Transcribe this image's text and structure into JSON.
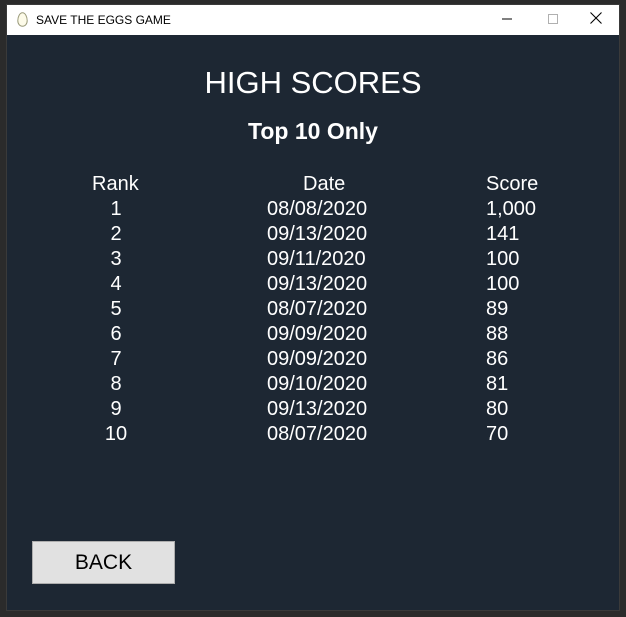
{
  "window": {
    "title": "SAVE THE EGGS GAME",
    "icon": "egg-icon",
    "controls": [
      "minimize-icon",
      "maximize-icon",
      "close-icon"
    ]
  },
  "screen": {
    "title": "HIGH SCORES",
    "subtitle": "Top 10 Only"
  },
  "table": {
    "headers": {
      "rank": "Rank",
      "date": "Date",
      "score": "Score"
    },
    "rows": [
      {
        "rank": "1",
        "date": "08/08/2020",
        "score": "1,000"
      },
      {
        "rank": "2",
        "date": "09/13/2020",
        "score": "141"
      },
      {
        "rank": "3",
        "date": "09/11/2020",
        "score": "100"
      },
      {
        "rank": "4",
        "date": "09/13/2020",
        "score": "100"
      },
      {
        "rank": "5",
        "date": "08/07/2020",
        "score": "89"
      },
      {
        "rank": "6",
        "date": "09/09/2020",
        "score": "88"
      },
      {
        "rank": "7",
        "date": "09/09/2020",
        "score": "86"
      },
      {
        "rank": "8",
        "date": "09/10/2020",
        "score": "81"
      },
      {
        "rank": "9",
        "date": "09/13/2020",
        "score": "80"
      },
      {
        "rank": "10",
        "date": "08/07/2020",
        "score": "70"
      }
    ]
  },
  "actions": {
    "back_label": "BACK"
  },
  "colors": {
    "background": "#1d2733",
    "text": "#ffffff",
    "button_bg": "#e1e1e1"
  }
}
